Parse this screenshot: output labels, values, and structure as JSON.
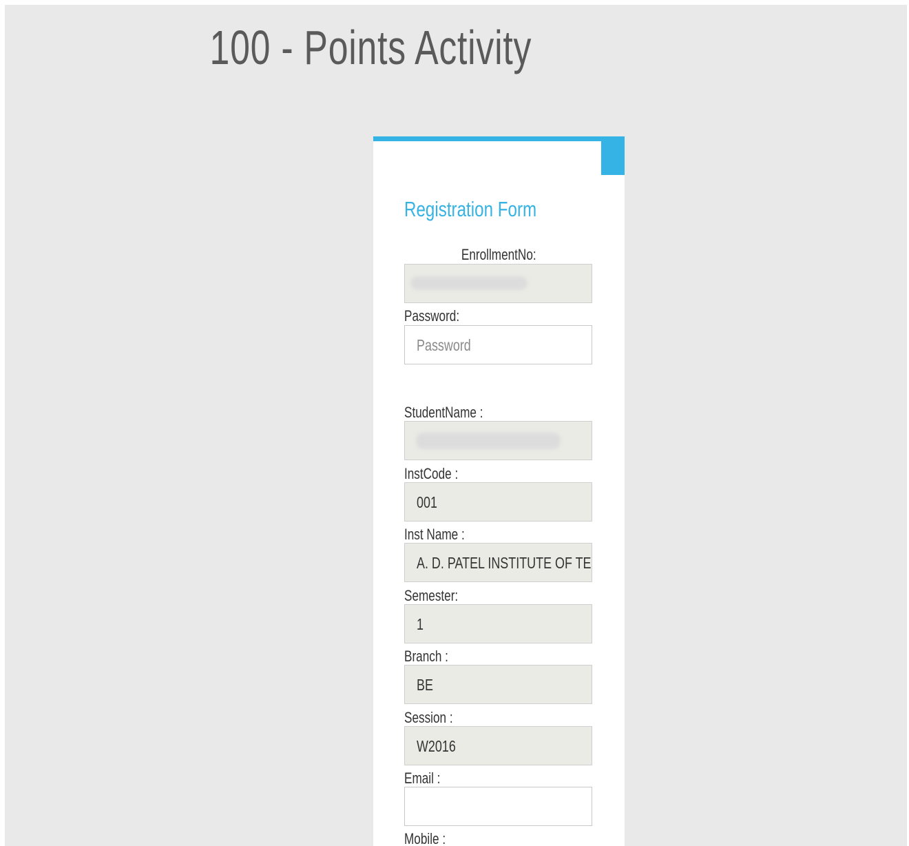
{
  "page": {
    "title": "100 - Points Activity"
  },
  "colors": {
    "accent": "#35b3e5",
    "background": "#e9e9e9",
    "readonly_field": "#ebebe6"
  },
  "form": {
    "heading": "Registration Form",
    "enrollment": {
      "label": "EnrollmentNo:",
      "value": ""
    },
    "password": {
      "label": "Password:",
      "placeholder": "Password",
      "value": ""
    },
    "student_name": {
      "label": "StudentName :",
      "value": ""
    },
    "inst_code": {
      "label": "InstCode :",
      "value": "001"
    },
    "inst_name": {
      "label": "Inst Name :",
      "value": "A. D. PATEL INSTITUTE OF TECH"
    },
    "semester": {
      "label": "Semester:",
      "value": "1"
    },
    "branch": {
      "label": "Branch :",
      "value": "BE"
    },
    "session": {
      "label": "Session :",
      "value": "W2016"
    },
    "email": {
      "label": "Email :",
      "value": ""
    },
    "mobile": {
      "label": "Mobile :",
      "value": ""
    }
  }
}
